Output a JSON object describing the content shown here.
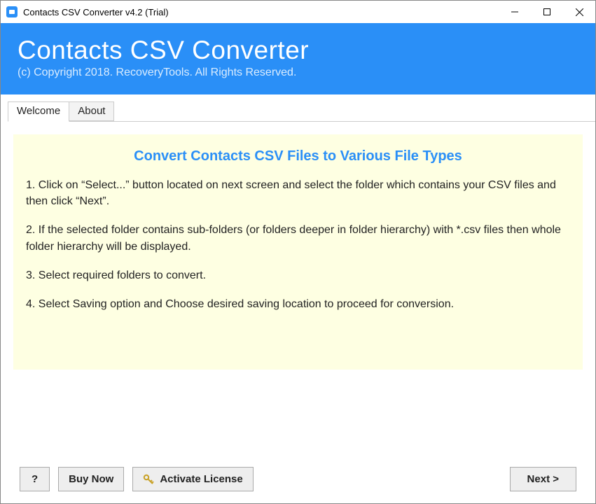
{
  "window": {
    "title": "Contacts CSV Converter v4.2 (Trial)"
  },
  "banner": {
    "title": "Contacts CSV Converter",
    "copyright": "(c) Copyright 2018. RecoveryTools. All Rights Reserved."
  },
  "tabs": {
    "welcome": "Welcome",
    "about": "About"
  },
  "welcome": {
    "heading": "Convert Contacts CSV Files to Various File Types",
    "step1": "1. Click on “Select...” button located on next screen and select the folder which contains your CSV files and then click “Next”.",
    "step2": "2. If the selected folder contains sub-folders (or folders deeper in folder hierarchy) with *.csv files then whole folder hierarchy will be displayed.",
    "step3": "3. Select required folders to convert.",
    "step4": "4. Select Saving option and Choose desired saving location to proceed for conversion."
  },
  "buttons": {
    "help": "?",
    "buy": "Buy Now",
    "activate": "Activate License",
    "next": "Next >"
  }
}
